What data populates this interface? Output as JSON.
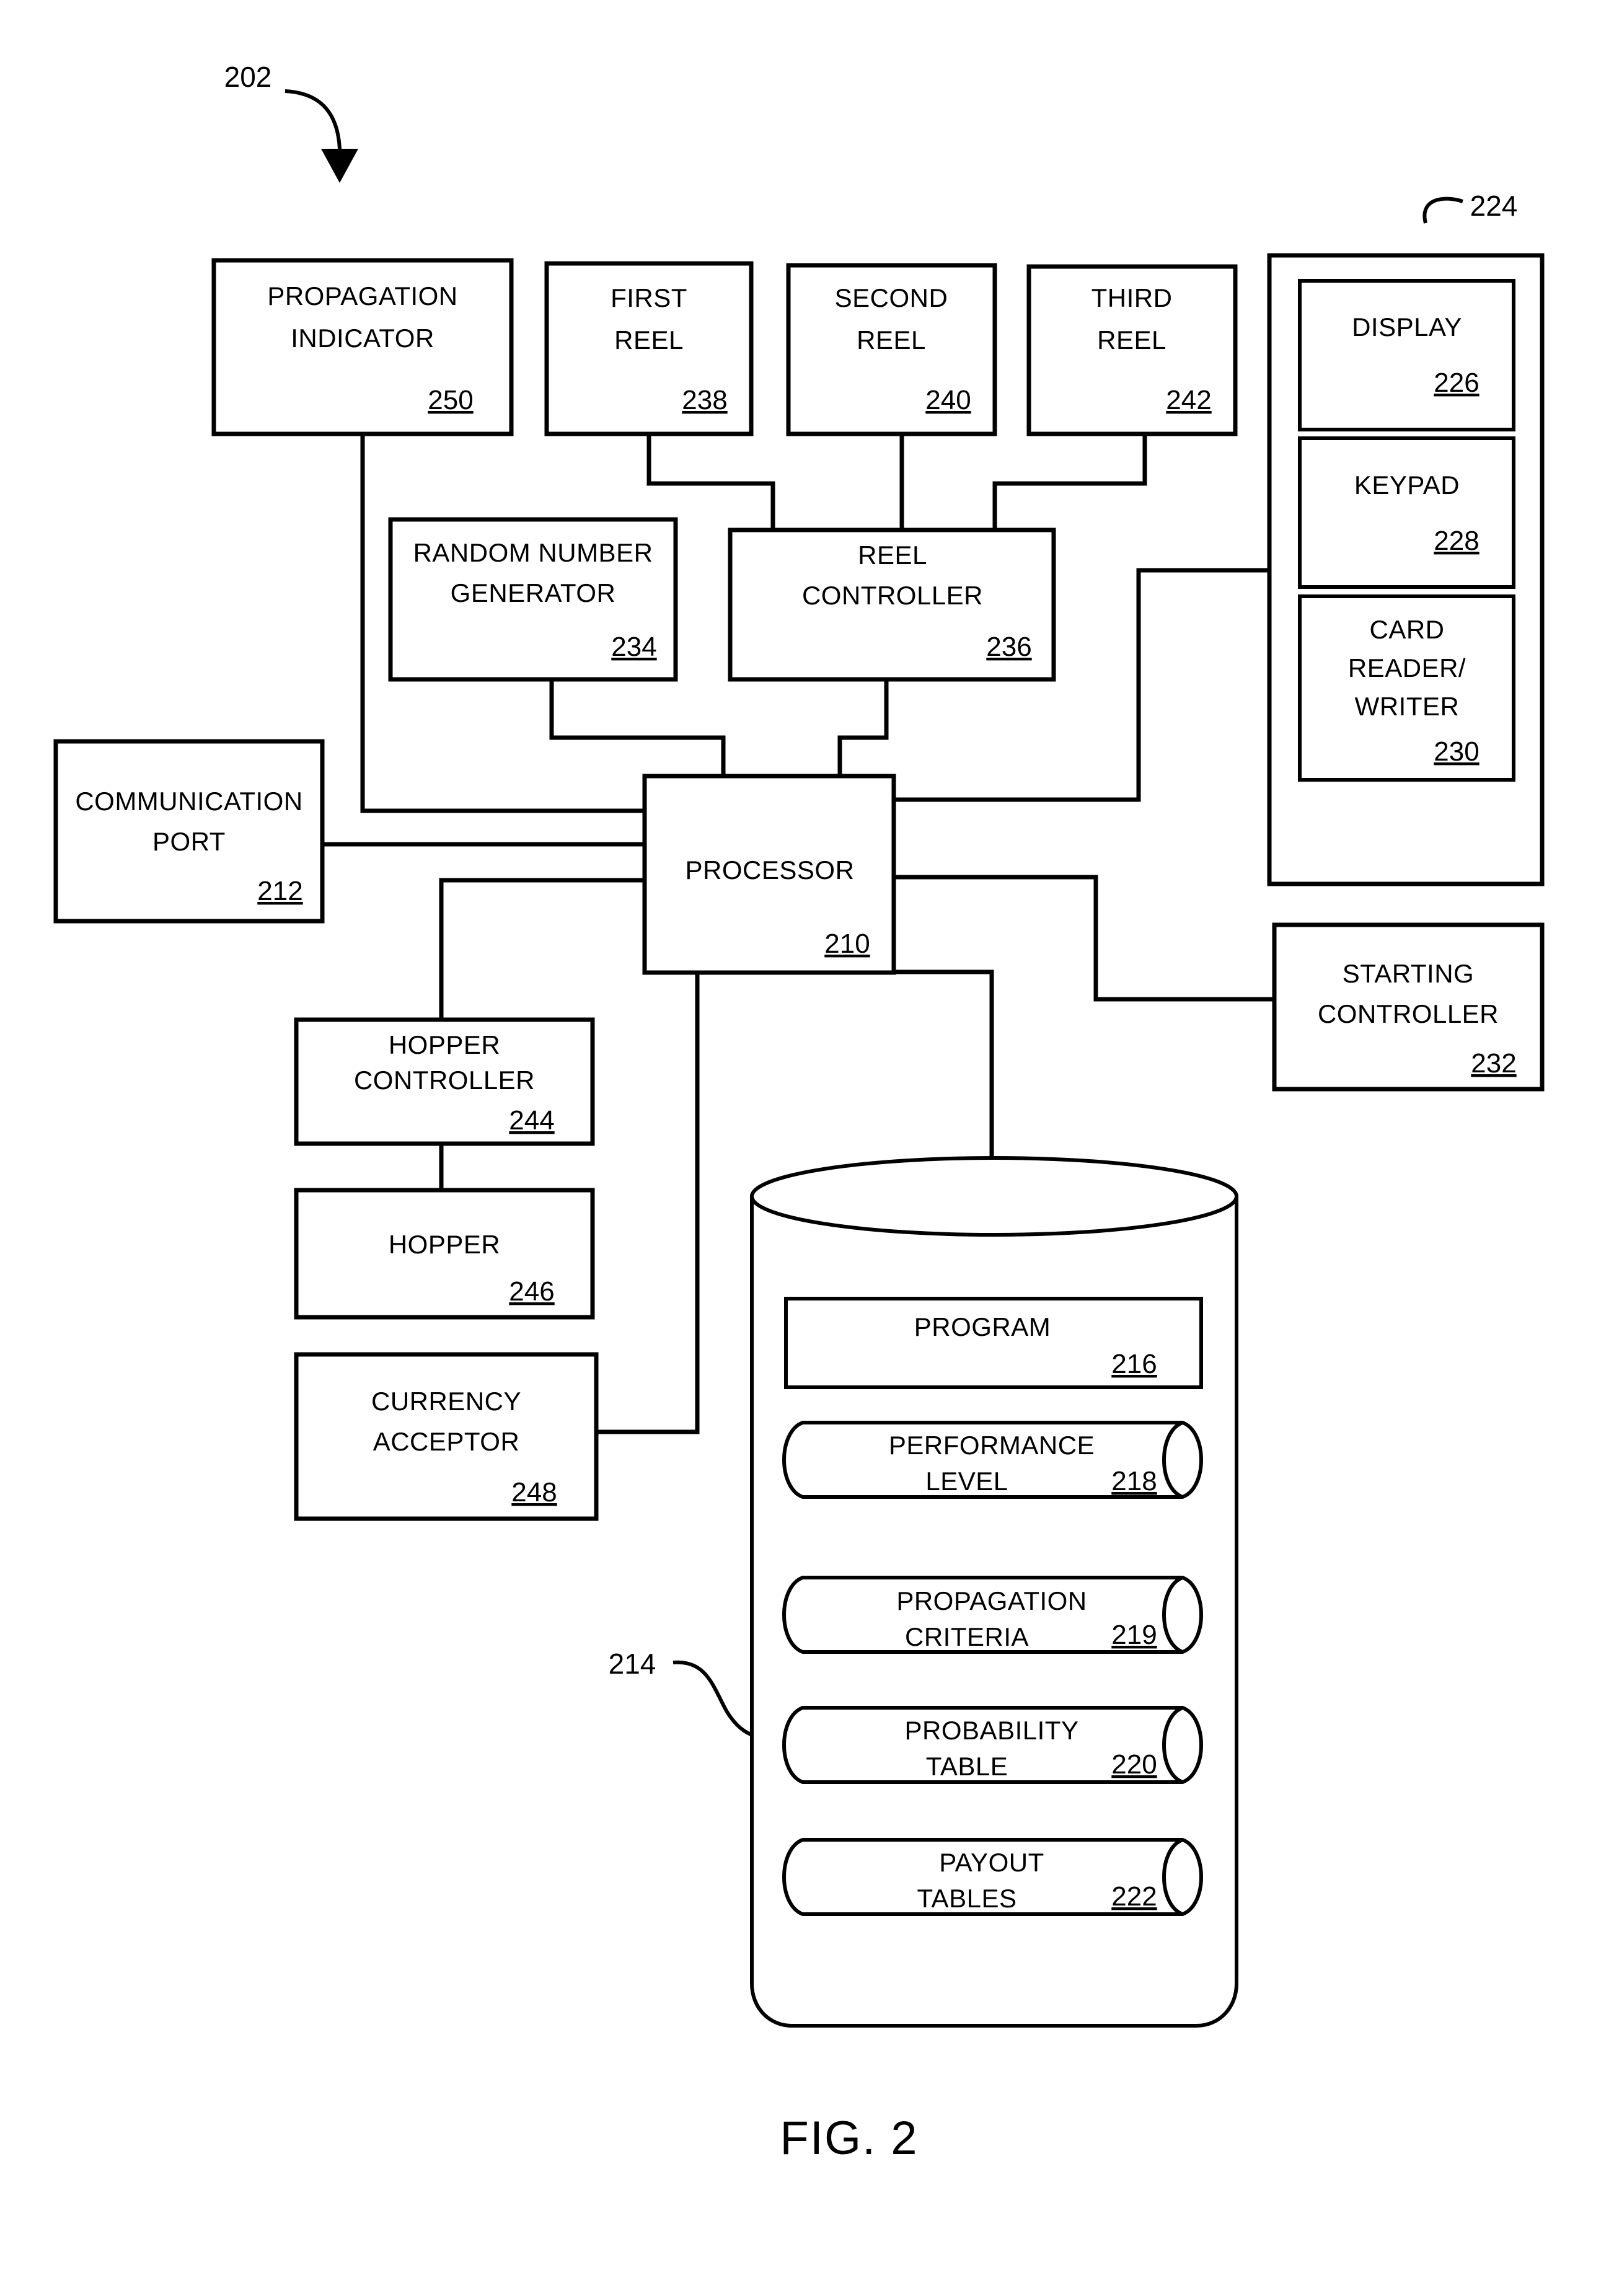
{
  "figure": {
    "caption": "FIG. 2",
    "system_ref": "202",
    "memory_ref": "214",
    "io_panel_ref": "224"
  },
  "blocks": {
    "propagation_indicator": {
      "line1": "PROPAGATION",
      "line2": "INDICATOR",
      "ref": "250"
    },
    "first_reel": {
      "line1": "FIRST",
      "line2": "REEL",
      "ref": "238"
    },
    "second_reel": {
      "line1": "SECOND",
      "line2": "REEL",
      "ref": "240"
    },
    "third_reel": {
      "line1": "THIRD",
      "line2": "REEL",
      "ref": "242"
    },
    "random_number_generator": {
      "line1": "RANDOM NUMBER",
      "line2": "GENERATOR",
      "ref": "234"
    },
    "reel_controller": {
      "line1": "REEL",
      "line2": "CONTROLLER",
      "ref": "236"
    },
    "communication_port": {
      "line1": "COMMUNICATION",
      "line2": "PORT",
      "ref": "212"
    },
    "processor": {
      "line1": "PROCESSOR",
      "line2": "",
      "ref": "210"
    },
    "hopper_controller": {
      "line1": "HOPPER",
      "line2": "CONTROLLER",
      "ref": "244"
    },
    "hopper": {
      "line1": "HOPPER",
      "line2": "",
      "ref": "246"
    },
    "currency_acceptor": {
      "line1": "CURRENCY",
      "line2": "ACCEPTOR",
      "ref": "248"
    },
    "starting_controller": {
      "line1": "STARTING",
      "line2": "CONTROLLER",
      "ref": "232"
    },
    "display": {
      "line1": "DISPLAY",
      "line2": "",
      "ref": "226"
    },
    "keypad": {
      "line1": "KEYPAD",
      "line2": "",
      "ref": "228"
    },
    "card_reader_writer": {
      "line1": "CARD",
      "line2": "READER/",
      "line3": "WRITER",
      "ref": "230"
    },
    "program": {
      "line1": "PROGRAM",
      "line2": "",
      "ref": "216"
    },
    "performance_level": {
      "line1": "PERFORMANCE",
      "line2": "LEVEL",
      "ref": "218"
    },
    "propagation_criteria": {
      "line1": "PROPAGATION",
      "line2": "CRITERIA",
      "ref": "219"
    },
    "probability_table": {
      "line1": "PROBABILITY",
      "line2": "TABLE",
      "ref": "220"
    },
    "payout_tables": {
      "line1": "PAYOUT",
      "line2": "TABLES",
      "ref": "222"
    }
  },
  "colors": {
    "stroke": "#000000",
    "fill": "#ffffff"
  }
}
